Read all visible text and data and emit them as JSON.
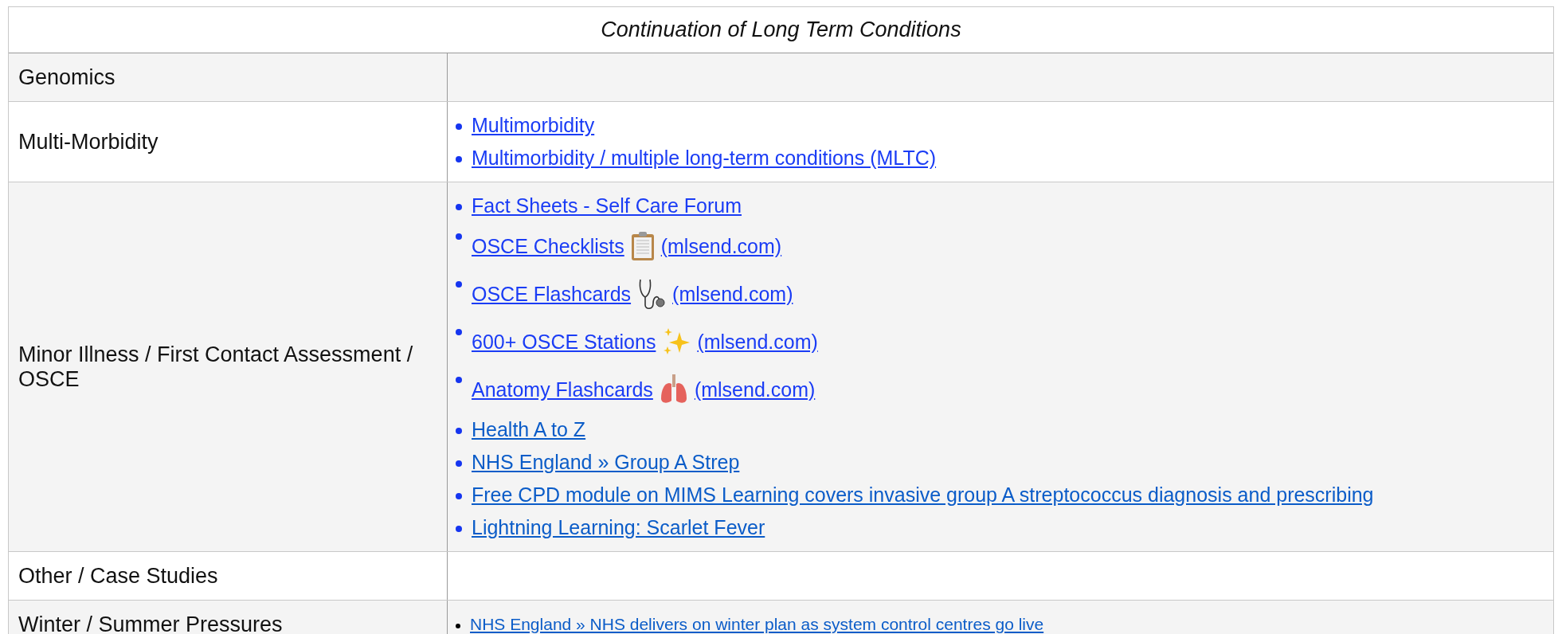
{
  "title": "Continuation of Long Term Conditions",
  "rows": [
    {
      "label": "Genomics",
      "links": []
    },
    {
      "label": "Multi-Morbidity",
      "links": [
        {
          "text": "Multimorbidity",
          "kind": "plain"
        },
        {
          "text": "Multimorbidity / multiple long-term conditions (MLTC)",
          "kind": "plain"
        }
      ]
    },
    {
      "label": "Minor Illness / First Contact Assessment / OSCE",
      "links": [
        {
          "text": "Fact Sheets - Self Care Forum",
          "kind": "plain"
        },
        {
          "text": "OSCE Checklists",
          "suffix": "(mlsend.com)",
          "kind": "clipboard"
        },
        {
          "text": "OSCE Flashcards",
          "suffix": "(mlsend.com)",
          "kind": "stethoscope"
        },
        {
          "text": "600+ OSCE Stations",
          "suffix": "(mlsend.com)",
          "kind": "sparkles"
        },
        {
          "text": "Anatomy Flashcards",
          "suffix": "(mlsend.com)",
          "kind": "lungs"
        },
        {
          "text": "Health A to Z",
          "kind": "plain"
        },
        {
          "text": "NHS England » Group A Strep",
          "kind": "plain"
        },
        {
          "text": "Free CPD module on MIMS Learning covers invasive group A streptococcus diagnosis and prescribing",
          "kind": "plain"
        },
        {
          "text": "Lightning Learning: Scarlet Fever",
          "kind": "plain"
        }
      ]
    },
    {
      "label": "Other / Case Studies",
      "links": []
    },
    {
      "label": "Winter / Summer Pressures",
      "links": [
        {
          "text": "NHS England » NHS delivers on winter plan as system control centres go live",
          "kind": "small"
        }
      ]
    }
  ]
}
